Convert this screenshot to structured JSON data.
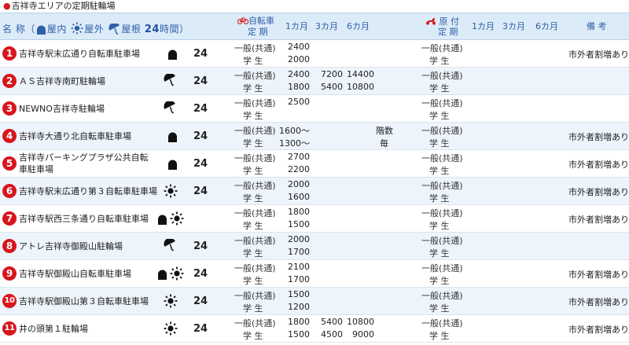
{
  "page_title": "吉祥寺エリアの定期駐輪場",
  "header": {
    "name_label": "名 称",
    "legend_indoor": "屋内",
    "legend_outdoor": "屋外",
    "legend_roof": "屋根",
    "legend_24": "24",
    "legend_24_suffix": "時間",
    "bicycle_label_1": "自転車",
    "bicycle_label_2": "定 期",
    "m1": "1カ月",
    "m3": "3カ月",
    "m6": "6カ月",
    "moped_label_1": "原 付",
    "moped_label_2": "定 期",
    "m1b": "1カ月",
    "m3b": "3カ月",
    "m6b": "6カ月",
    "remarks": "備 考"
  },
  "labels": {
    "general": "一般(共通)",
    "student": "学 生"
  },
  "colors": {
    "header_bg": "#dcebf8",
    "header_text": "#2f5fa8",
    "number_badge": "#d8151c",
    "row_alt": "#edf4fb"
  },
  "rows": [
    {
      "no": "1",
      "name": "吉祥寺駅末広通り自転車駐車場",
      "icons": [
        "indoor"
      ],
      "h24": "24",
      "gen": [
        "2400",
        "",
        ""
      ],
      "stu": [
        "2000",
        "",
        ""
      ],
      "note": "市外者割増あり"
    },
    {
      "no": "2",
      "name": "ＡＳ吉祥寺南町駐輪場",
      "icons": [
        "roof"
      ],
      "h24": "24",
      "gen": [
        "2400",
        "7200",
        "14400"
      ],
      "stu": [
        "1800",
        "5400",
        "10800"
      ],
      "note": ""
    },
    {
      "no": "3",
      "name": "NEWNO吉祥寺駐輪場",
      "icons": [
        "roof"
      ],
      "h24": "24",
      "gen": [
        "2500",
        "",
        ""
      ],
      "stu": [
        "",
        "",
        ""
      ],
      "note": ""
    },
    {
      "no": "4",
      "name": "吉祥寺大通り北自転車駐車場",
      "icons": [
        "indoor"
      ],
      "h24": "24",
      "gen": [
        "1600～",
        "",
        ""
      ],
      "stu": [
        "1300～",
        "",
        ""
      ],
      "special_1": "階数",
      "special_2": "毎",
      "note": "市外者割増あり"
    },
    {
      "no": "5",
      "name": "吉祥寺パーキングプラザ公共自転車駐車場",
      "icons": [
        "indoor"
      ],
      "h24": "24",
      "gen": [
        "2700",
        "",
        ""
      ],
      "stu": [
        "2200",
        "",
        ""
      ],
      "note": "市外者割増あり"
    },
    {
      "no": "6",
      "name": "吉祥寺駅末広通り第３自転車駐車場",
      "icons": [
        "outdoor"
      ],
      "h24": "24",
      "gen": [
        "2000",
        "",
        ""
      ],
      "stu": [
        "1600",
        "",
        ""
      ],
      "note": "市外者割増あり"
    },
    {
      "no": "7",
      "name": "吉祥寺駅西三条通り自転車駐車場",
      "icons": [
        "indoor",
        "outdoor"
      ],
      "h24": "",
      "gen": [
        "1800",
        "",
        ""
      ],
      "stu": [
        "1500",
        "",
        ""
      ],
      "note": "市外者割増あり"
    },
    {
      "no": "8",
      "name": "アトレ吉祥寺御殿山駐輪場",
      "icons": [
        "roof"
      ],
      "h24": "24",
      "gen": [
        "2000",
        "",
        ""
      ],
      "stu": [
        "1700",
        "",
        ""
      ],
      "note": ""
    },
    {
      "no": "9",
      "name": "吉祥寺駅御殿山自転車駐車場",
      "icons": [
        "indoor",
        "outdoor"
      ],
      "h24": "24",
      "gen": [
        "2100",
        "",
        ""
      ],
      "stu": [
        "1700",
        "",
        ""
      ],
      "note": "市外者割増あり"
    },
    {
      "no": "10",
      "name": "吉祥寺駅御殿山第３自転車駐車場",
      "icons": [
        "outdoor"
      ],
      "h24": "24",
      "gen": [
        "1500",
        "",
        ""
      ],
      "stu": [
        "1200",
        "",
        ""
      ],
      "note": "市外者割増あり"
    },
    {
      "no": "11",
      "name": "井の頭第１駐輪場",
      "icons": [
        "outdoor"
      ],
      "h24": "24",
      "gen": [
        "1800",
        "5400",
        "10800"
      ],
      "stu": [
        "1500",
        "4500",
        "9000"
      ],
      "note": "市外者割増あり"
    }
  ]
}
